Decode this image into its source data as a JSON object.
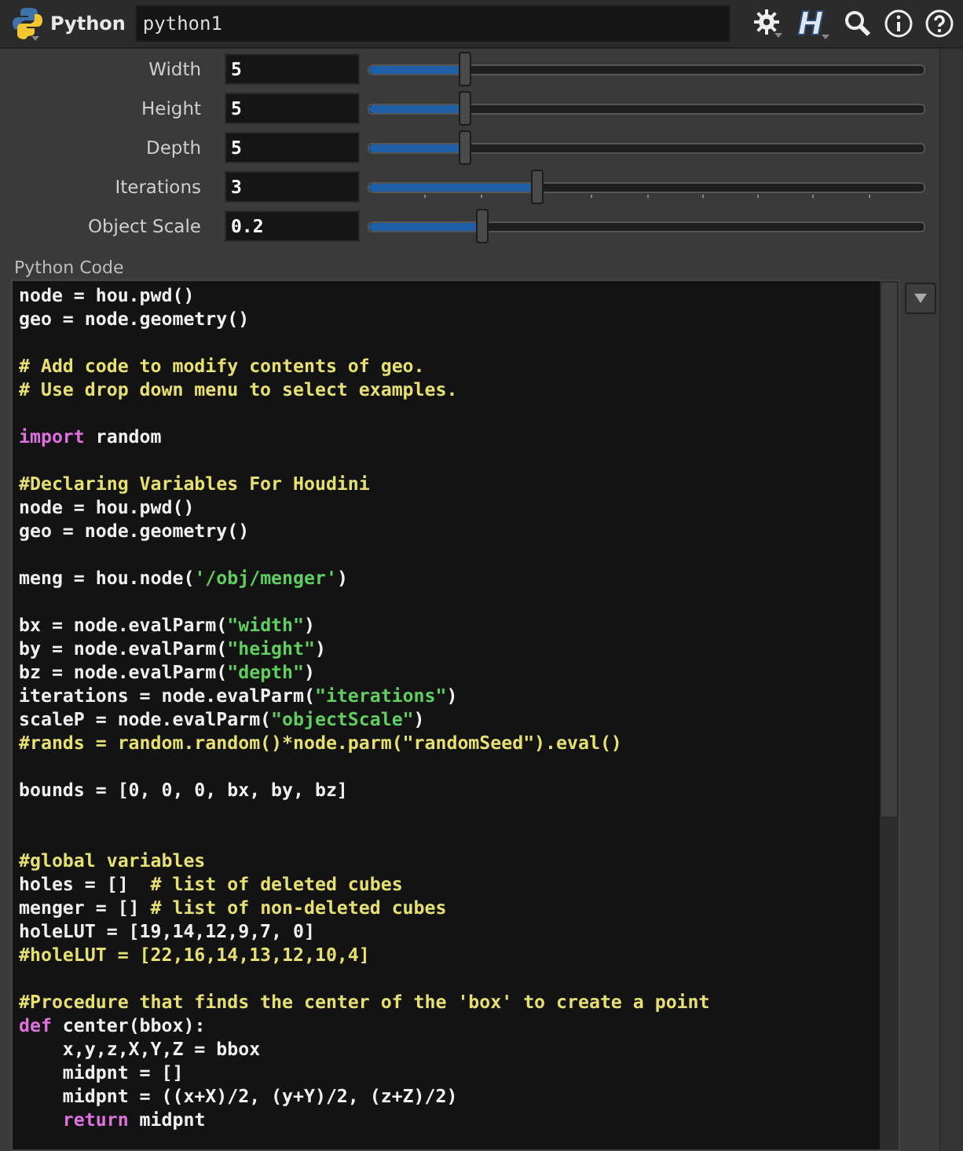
{
  "header": {
    "type_label": "Python",
    "node_name": "python1"
  },
  "parameters": [
    {
      "label": "Width",
      "value": "5",
      "level": 0.17,
      "ticks": false
    },
    {
      "label": "Height",
      "value": "5",
      "level": 0.17,
      "ticks": false
    },
    {
      "label": "Depth",
      "value": "5",
      "level": 0.17,
      "ticks": false
    },
    {
      "label": "Iterations",
      "value": "3",
      "level": 0.3,
      "ticks": true
    },
    {
      "label": "Object Scale",
      "value": "0.2",
      "level": 0.2,
      "ticks": false
    }
  ],
  "code_label": "Python Code",
  "code_lines": [
    {
      "kind": "code",
      "tokens": [
        {
          "kind": "plain",
          "text": "node = hou.pwd()"
        }
      ]
    },
    {
      "kind": "code",
      "tokens": [
        {
          "kind": "plain",
          "text": "geo = node.geometry()"
        }
      ]
    },
    {
      "kind": "blank"
    },
    {
      "kind": "code",
      "tokens": [
        {
          "kind": "comment",
          "text": "# Add code to modify contents of geo."
        }
      ]
    },
    {
      "kind": "code",
      "tokens": [
        {
          "kind": "comment",
          "text": "# Use drop down menu to select examples."
        }
      ]
    },
    {
      "kind": "blank"
    },
    {
      "kind": "code",
      "tokens": [
        {
          "kind": "keyword",
          "text": "import"
        },
        {
          "kind": "plain",
          "text": " random"
        }
      ]
    },
    {
      "kind": "blank"
    },
    {
      "kind": "code",
      "tokens": [
        {
          "kind": "comment",
          "text": "#Declaring Variables For Houdini"
        }
      ]
    },
    {
      "kind": "code",
      "tokens": [
        {
          "kind": "plain",
          "text": "node = hou.pwd()"
        }
      ]
    },
    {
      "kind": "code",
      "tokens": [
        {
          "kind": "plain",
          "text": "geo = node.geometry()"
        }
      ]
    },
    {
      "kind": "blank"
    },
    {
      "kind": "code",
      "tokens": [
        {
          "kind": "plain",
          "text": "meng = hou.node("
        },
        {
          "kind": "string",
          "text": "'/obj/menger'"
        },
        {
          "kind": "plain",
          "text": ")"
        }
      ]
    },
    {
      "kind": "blank"
    },
    {
      "kind": "code",
      "tokens": [
        {
          "kind": "plain",
          "text": "bx = node.evalParm("
        },
        {
          "kind": "string",
          "text": "\"width\""
        },
        {
          "kind": "plain",
          "text": ")"
        }
      ]
    },
    {
      "kind": "code",
      "tokens": [
        {
          "kind": "plain",
          "text": "by = node.evalParm("
        },
        {
          "kind": "string",
          "text": "\"height\""
        },
        {
          "kind": "plain",
          "text": ")"
        }
      ]
    },
    {
      "kind": "code",
      "tokens": [
        {
          "kind": "plain",
          "text": "bz = node.evalParm("
        },
        {
          "kind": "string",
          "text": "\"depth\""
        },
        {
          "kind": "plain",
          "text": ")"
        }
      ]
    },
    {
      "kind": "code",
      "tokens": [
        {
          "kind": "plain",
          "text": "iterations = node.evalParm("
        },
        {
          "kind": "string",
          "text": "\"iterations\""
        },
        {
          "kind": "plain",
          "text": ")"
        }
      ]
    },
    {
      "kind": "code",
      "tokens": [
        {
          "kind": "plain",
          "text": "scaleP = node.evalParm("
        },
        {
          "kind": "string",
          "text": "\"objectScale\""
        },
        {
          "kind": "plain",
          "text": ")"
        }
      ]
    },
    {
      "kind": "code",
      "tokens": [
        {
          "kind": "comment",
          "text": "#rands = random.random()*node.parm(\"randomSeed\").eval()"
        }
      ]
    },
    {
      "kind": "blank"
    },
    {
      "kind": "code",
      "tokens": [
        {
          "kind": "plain",
          "text": "bounds = [0, 0, 0, bx, by, bz]"
        }
      ]
    },
    {
      "kind": "blank"
    },
    {
      "kind": "blank"
    },
    {
      "kind": "code",
      "tokens": [
        {
          "kind": "comment",
          "text": "#global variables"
        }
      ]
    },
    {
      "kind": "code",
      "tokens": [
        {
          "kind": "plain",
          "text": "holes = []  "
        },
        {
          "kind": "comment",
          "text": "# list of deleted cubes"
        }
      ]
    },
    {
      "kind": "code",
      "tokens": [
        {
          "kind": "plain",
          "text": "menger = [] "
        },
        {
          "kind": "comment",
          "text": "# list of non-deleted cubes"
        }
      ]
    },
    {
      "kind": "code",
      "tokens": [
        {
          "kind": "plain",
          "text": "holeLUT = [19,14,12,9,7, 0]"
        }
      ]
    },
    {
      "kind": "code",
      "tokens": [
        {
          "kind": "comment",
          "text": "#holeLUT = [22,16,14,13,12,10,4]"
        }
      ]
    },
    {
      "kind": "blank"
    },
    {
      "kind": "code",
      "tokens": [
        {
          "kind": "comment",
          "text": "#Procedure that finds the center of the 'box' to create a point"
        }
      ]
    },
    {
      "kind": "code",
      "tokens": [
        {
          "kind": "keyword",
          "text": "def"
        },
        {
          "kind": "plain",
          "text": " center(bbox):"
        }
      ]
    },
    {
      "kind": "code",
      "tokens": [
        {
          "kind": "plain",
          "text": "    x,y,z,X,Y,Z = bbox"
        }
      ]
    },
    {
      "kind": "code",
      "tokens": [
        {
          "kind": "plain",
          "text": "    midpnt = []"
        }
      ]
    },
    {
      "kind": "code",
      "tokens": [
        {
          "kind": "plain",
          "text": "    midpnt = ((x+X)/2, (y+Y)/2, (z+Z)/2)"
        }
      ]
    },
    {
      "kind": "code",
      "tokens": [
        {
          "kind": "keyword",
          "text": "    return"
        },
        {
          "kind": "plain",
          "text": " midpnt"
        }
      ]
    }
  ]
}
